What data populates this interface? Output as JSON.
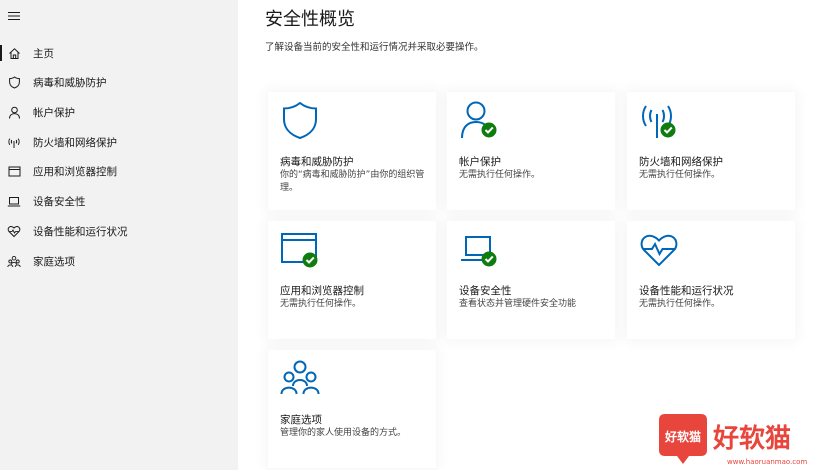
{
  "sidebar": {
    "items": [
      {
        "label": "主页",
        "icon": "home-icon",
        "selected": true
      },
      {
        "label": "病毒和威胁防护",
        "icon": "shield-icon"
      },
      {
        "label": "帐户保护",
        "icon": "person-icon"
      },
      {
        "label": "防火墙和网络保护",
        "icon": "wifi-icon"
      },
      {
        "label": "应用和浏览器控制",
        "icon": "browser-window-icon"
      },
      {
        "label": "设备安全性",
        "icon": "laptop-icon"
      },
      {
        "label": "设备性能和运行状况",
        "icon": "heart-icon"
      },
      {
        "label": "家庭选项",
        "icon": "family-icon"
      }
    ]
  },
  "main": {
    "title": "安全性概览",
    "subtitle": "了解设备当前的安全性和运行情况并采取必要操作。",
    "cards": [
      {
        "title": "病毒和威胁防护",
        "desc": "你的“病毒和威胁防护”由你的组织管理。",
        "icon": "shield-icon",
        "status": "none"
      },
      {
        "title": "帐户保护",
        "desc": "无需执行任何操作。",
        "icon": "person-icon",
        "status": "ok"
      },
      {
        "title": "防火墙和网络保护",
        "desc": "无需执行任何操作。",
        "icon": "wifi-icon",
        "status": "ok"
      },
      {
        "title": "应用和浏览器控制",
        "desc": "无需执行任何操作。",
        "icon": "browser-window-icon",
        "status": "ok"
      },
      {
        "title": "设备安全性",
        "desc": "查看状态并管理硬件安全功能",
        "icon": "laptop-icon",
        "status": "ok"
      },
      {
        "title": "设备性能和运行状况",
        "desc": "无需执行任何操作。",
        "icon": "heart-pulse-icon",
        "status": "none"
      },
      {
        "title": "家庭选项",
        "desc": "管理你的家人使用设备的方式。",
        "icon": "family-icon",
        "status": "none"
      }
    ]
  },
  "watermark": {
    "badge_text": "好软猫",
    "brand_text": "好软猫",
    "url": "www.haoruanmao.com"
  },
  "colors": {
    "accent_blue": "#0067b8",
    "ok_green": "#107c10",
    "sidebar_bg": "#f2f2f2",
    "watermark_red": "#e8453c"
  }
}
